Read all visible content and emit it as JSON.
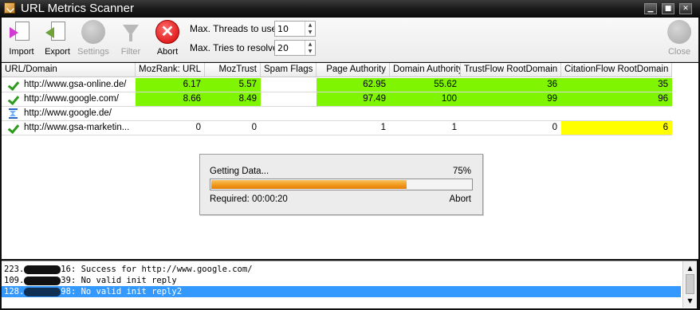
{
  "window": {
    "title": "URL Metrics Scanner"
  },
  "toolbar": {
    "import_label": "Import",
    "export_label": "Export",
    "settings_label": "Settings",
    "filter_label": "Filter",
    "abort_label": "Abort",
    "close_label": "Close",
    "threads_label": "Max. Threads to use",
    "threads_value": "10",
    "tries_label": "Max. Tries to resolve",
    "tries_value": "20"
  },
  "table": {
    "columns": [
      "URL/Domain",
      "MozRank: URL",
      "MozTrust",
      "Spam Flags",
      "Page Authority",
      "Domain Authority",
      "TrustFlow RootDomain",
      "CitationFlow RootDomain"
    ],
    "rows": [
      {
        "status": "check-icon",
        "url": "http://www.gsa-online.de/",
        "mozrank": "6.17",
        "moztrust": "5.57",
        "spam": "",
        "pa": "62.95",
        "da": "55.62",
        "tf": "36",
        "cf": "35"
      },
      {
        "status": "check-icon",
        "url": "http://www.google.com/",
        "mozrank": "8.66",
        "moztrust": "8.49",
        "spam": "",
        "pa": "97.49",
        "da": "100",
        "tf": "99",
        "cf": "96"
      },
      {
        "status": "hourglass-icon",
        "url": "http://www.google.de/",
        "mozrank": "",
        "moztrust": "",
        "spam": "",
        "pa": "",
        "da": "",
        "tf": "",
        "cf": ""
      },
      {
        "status": "check-icon",
        "url": "http://www.gsa-marketin...",
        "mozrank": "0",
        "moztrust": "0",
        "spam": "",
        "pa": "1",
        "da": "1",
        "tf": "0",
        "cf": "6"
      }
    ]
  },
  "progress": {
    "label": "Getting Data...",
    "percent_text": "75%",
    "percent": 75,
    "required": "Required: 00:00:20",
    "abort_label": "Abort"
  },
  "log": {
    "lines": [
      {
        "prefix": "223.",
        "suffix": "16: Success for http://www.google.com/"
      },
      {
        "prefix": "109.",
        "suffix": "39: No valid init reply"
      },
      {
        "prefix": "128.",
        "suffix": "98: No valid init reply2"
      }
    ]
  },
  "colors": {
    "highlight_green": "#7ff501",
    "highlight_yellow": "#ffff00",
    "selection": "#3399ff"
  }
}
